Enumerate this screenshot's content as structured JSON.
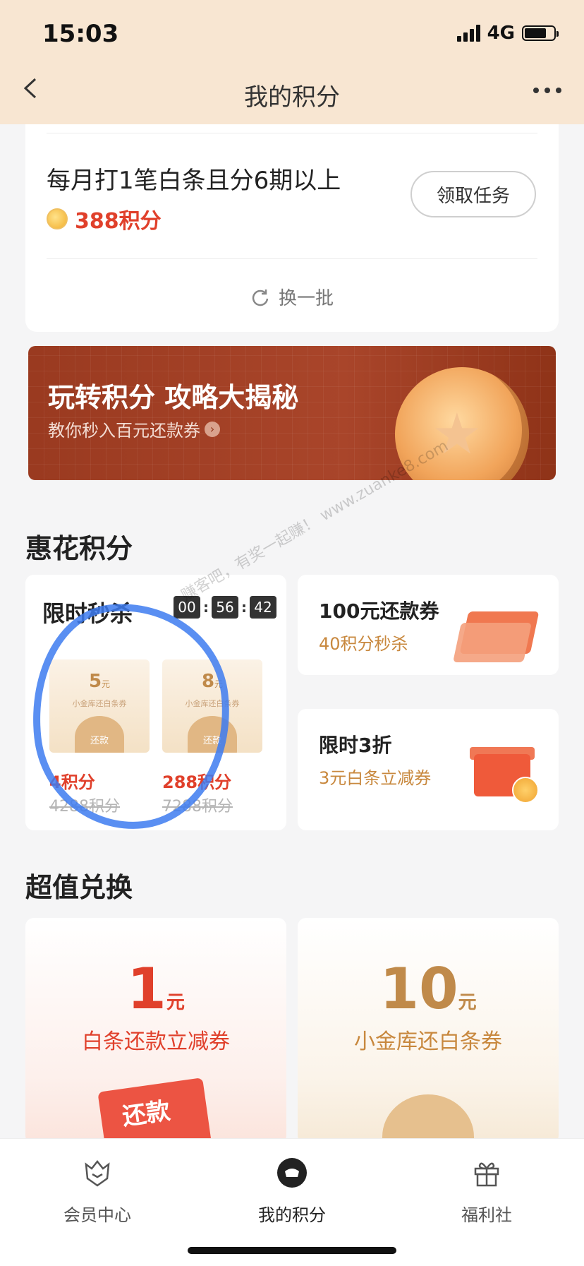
{
  "status": {
    "time": "15:03",
    "network": "4G"
  },
  "nav": {
    "title": "我的积分"
  },
  "task": {
    "title": "每月打1笔白条且分6期以上",
    "points": "388积分",
    "button": "领取任务",
    "refresh": "换一批"
  },
  "banner": {
    "title": "玩转积分 攻略大揭秘",
    "subtitle": "教你秒入百元还款券"
  },
  "section_huihua": {
    "title": "惠花积分"
  },
  "flash": {
    "title": "限时秒杀",
    "timer": {
      "h": "00",
      "m": "56",
      "s": "42"
    },
    "items": [
      {
        "amount": "5",
        "unit": "元",
        "name": "小金库还白条券",
        "tag": "还款",
        "price": "4积分",
        "original": "4288积分"
      },
      {
        "amount": "8",
        "unit": "元",
        "name": "小金库还白条券",
        "tag": "还款",
        "price": "288积分",
        "original": "7288积分"
      }
    ]
  },
  "side": [
    {
      "title": "100元还款券",
      "subtitle": "40积分秒杀"
    },
    {
      "title": "限时3折",
      "subtitle": "3元白条立减券"
    }
  ],
  "watermark": "赚客吧，有奖一起赚！ www.zuanke8.com",
  "section_exchange": {
    "title": "超值兑换"
  },
  "exchange": [
    {
      "amount": "1",
      "unit": "元",
      "name": "白条还款立减券",
      "tag": "还款",
      "color": "#e0402b"
    },
    {
      "amount": "10",
      "unit": "元",
      "name": "小金库还白条券",
      "color": "#c08a4a"
    }
  ],
  "tabs": [
    {
      "label": "会员中心",
      "icon": "member-icon"
    },
    {
      "label": "我的积分",
      "icon": "points-icon"
    },
    {
      "label": "福利社",
      "icon": "gift-icon"
    }
  ],
  "colors": {
    "accent_red": "#e0402b",
    "gold": "#c8883e",
    "header_bg": "#f8e6d2"
  }
}
